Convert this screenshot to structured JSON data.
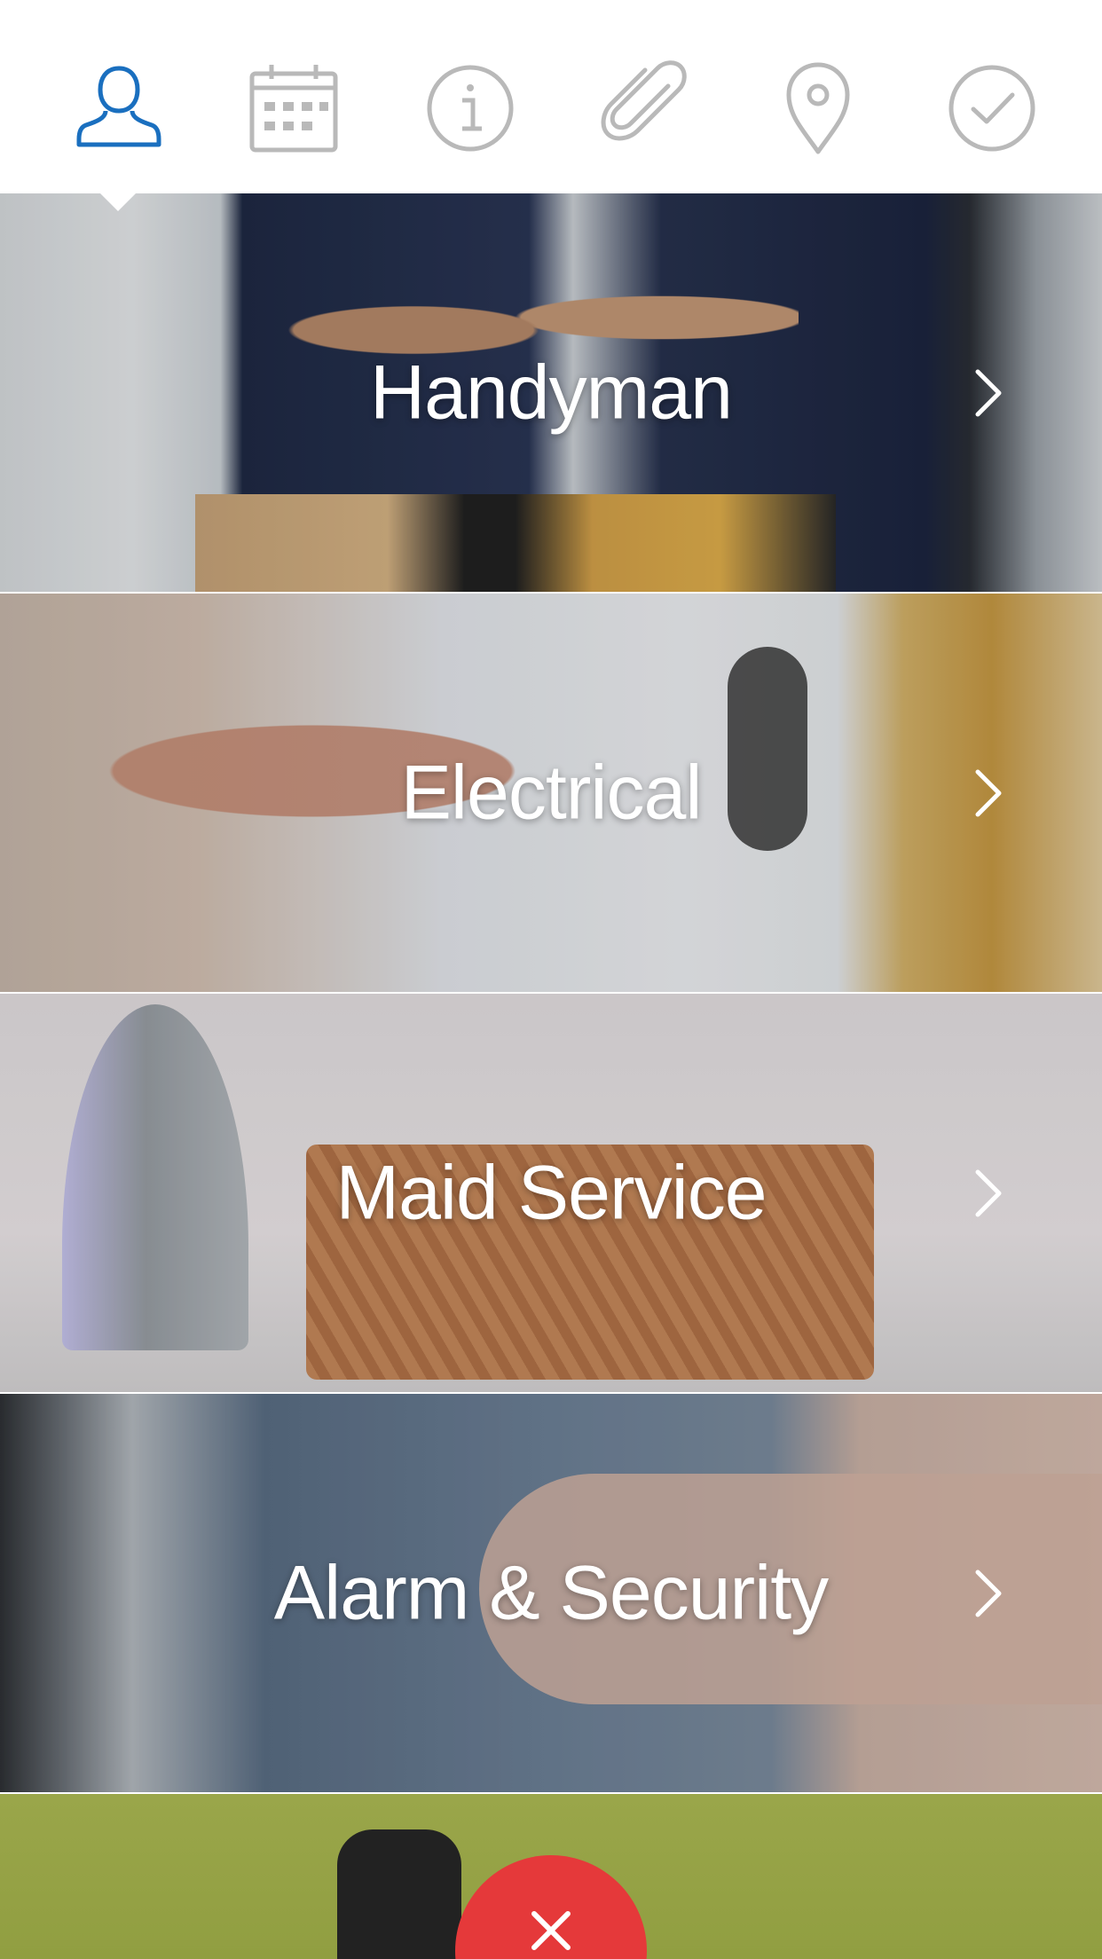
{
  "colors": {
    "active_step": "#1a6fbf",
    "inactive_step": "#b9b9b9",
    "title_text": "#ffffff",
    "close_button": "#e5393a"
  },
  "steps": [
    {
      "icon": "person-icon",
      "active": true
    },
    {
      "icon": "calendar-icon",
      "active": false
    },
    {
      "icon": "info-icon",
      "active": false
    },
    {
      "icon": "paperclip-icon",
      "active": false
    },
    {
      "icon": "location-pin-icon",
      "active": false
    },
    {
      "icon": "checkmark-icon",
      "active": false
    }
  ],
  "services": [
    {
      "title": "Handyman",
      "icon": "chevron-right-icon"
    },
    {
      "title": "Electrical",
      "icon": "chevron-right-icon"
    },
    {
      "title": "Maid Service",
      "icon": "chevron-right-icon"
    },
    {
      "title": "Alarm & Security",
      "icon": "chevron-right-icon"
    }
  ],
  "close_button": {
    "icon": "close-icon"
  }
}
